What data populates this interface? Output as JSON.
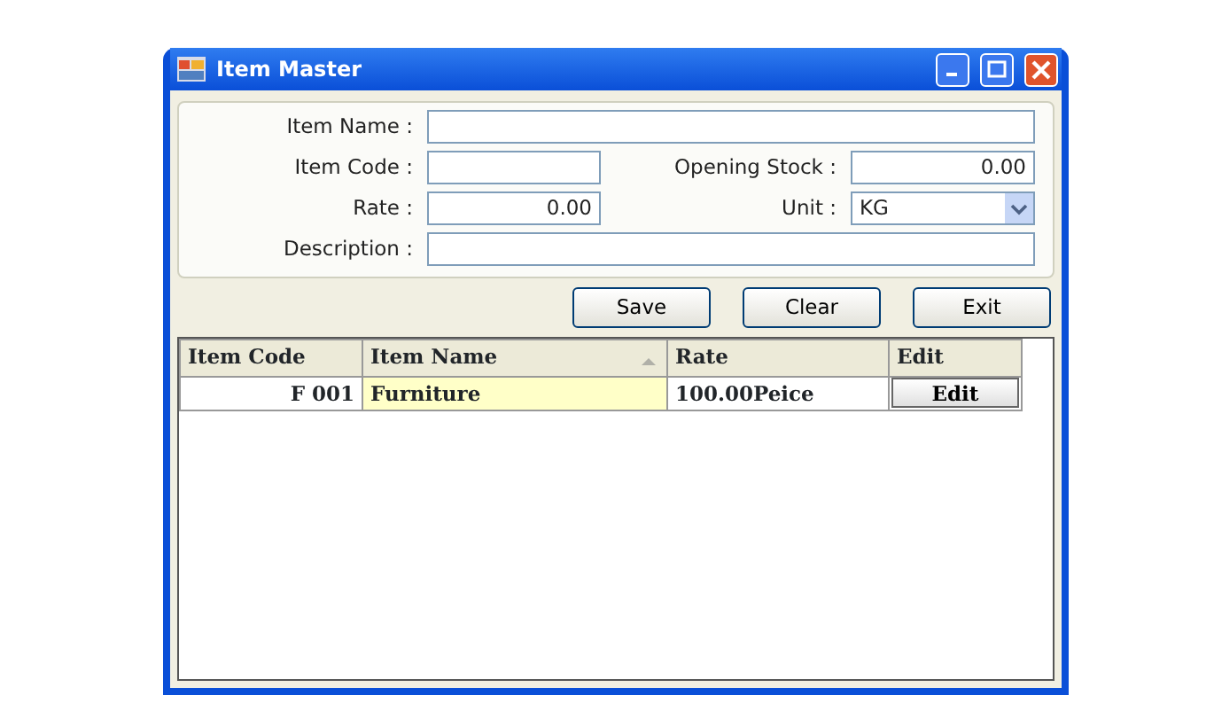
{
  "window": {
    "title": "Item Master"
  },
  "form": {
    "fields": [
      {
        "label": "Item Name :",
        "kind": "text"
      },
      {
        "label": "Item Code :",
        "kind": "text"
      },
      {
        "label": "Opening Stock :",
        "value": "0.00",
        "kind": "number"
      },
      {
        "label": "Rate :",
        "value": "0.00",
        "kind": "number"
      },
      {
        "label": "Unit :",
        "value": "KG",
        "kind": "select"
      },
      {
        "label": "Description :",
        "kind": "text"
      }
    ]
  },
  "buttons": [
    "Save",
    "Clear",
    "Exit"
  ],
  "table": {
    "columns": [
      {
        "label": "Item Code",
        "sorted": false
      },
      {
        "label": "Item Name",
        "sorted": true
      },
      {
        "label": "Rate",
        "sorted": false
      },
      {
        "label": "Edit",
        "sorted": false
      }
    ],
    "rows": [
      {
        "cells": [
          {
            "text": "F 001",
            "selected": false
          },
          {
            "text": "Furniture",
            "selected": true
          },
          {
            "text": "100.00Peice",
            "selected": false
          }
        ],
        "button": "Edit"
      }
    ]
  }
}
